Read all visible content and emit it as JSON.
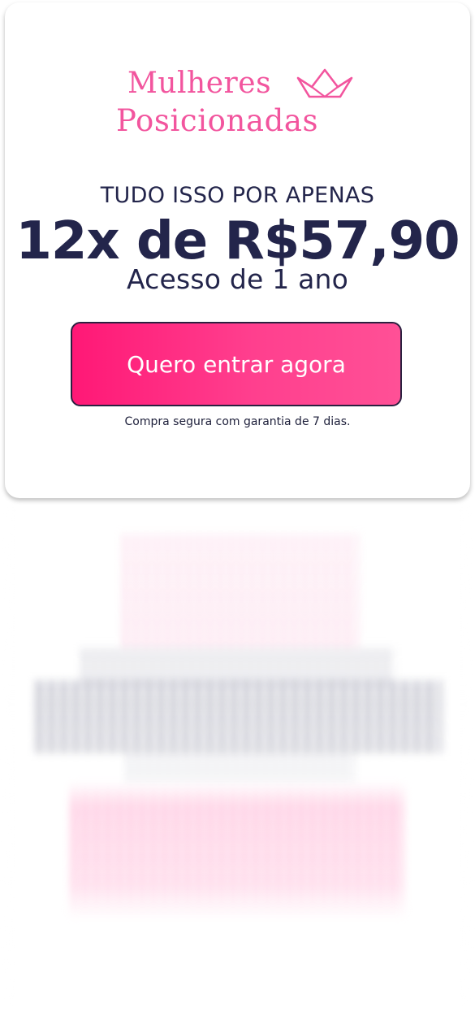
{
  "brand": {
    "line1": "Mulheres",
    "line2": "Posicionadas",
    "icon": "crown-icon",
    "color": "#f2559e"
  },
  "offer": {
    "headline": "TUDO ISSO POR APENAS",
    "price": "12x de R$57,90",
    "access": "Acesso de 1 ano"
  },
  "cta": {
    "label": "Quero entrar agora",
    "gradient_start": "#ff1876",
    "gradient_end": "#ff5096"
  },
  "guarantee": "Compra segura com garantia de 7 dias.",
  "colors": {
    "text_dark": "#23254b",
    "background": "#ffffff"
  }
}
